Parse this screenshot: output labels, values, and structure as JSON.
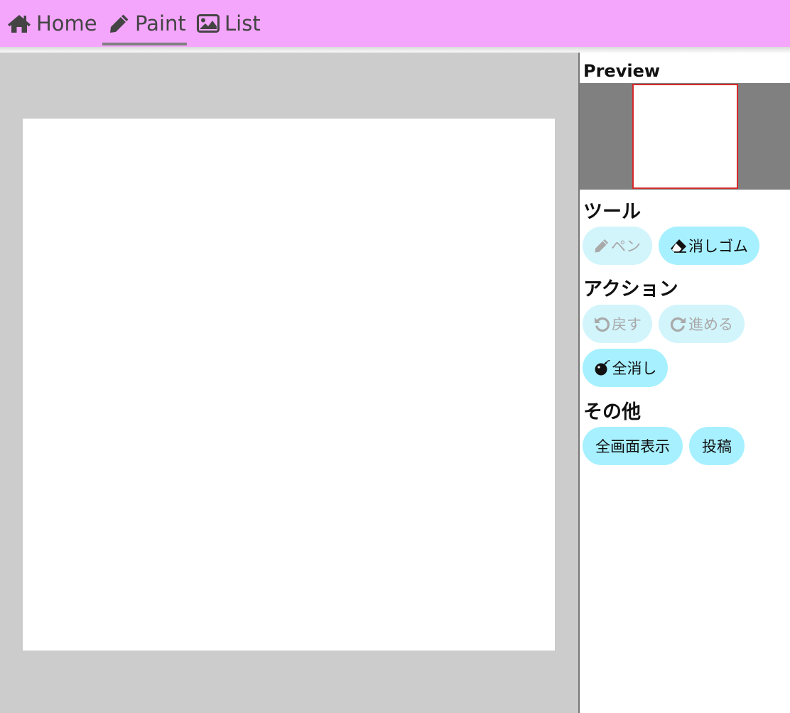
{
  "nav": {
    "items": [
      {
        "icon": "home-icon",
        "label": "Home"
      },
      {
        "icon": "pencil-icon",
        "label": "Paint"
      },
      {
        "icon": "image-icon",
        "label": "List"
      }
    ],
    "active": "Paint"
  },
  "panel": {
    "preview_heading": "Preview",
    "tools_heading": "ツール",
    "tools": {
      "pen": {
        "icon": "pencil-icon",
        "label": "ペン",
        "disabled": true
      },
      "eraser": {
        "icon": "eraser-icon",
        "label": "消しゴム",
        "disabled": false
      }
    },
    "action_heading": "アクション",
    "actions": {
      "undo": {
        "icon": "undo-icon",
        "label": "戻す",
        "disabled": true
      },
      "redo": {
        "icon": "redo-icon",
        "label": "進める",
        "disabled": true
      },
      "clear": {
        "icon": "bomb-icon",
        "label": "全消し",
        "disabled": false
      }
    },
    "other_heading": "その他",
    "other": {
      "fullscreen": {
        "label": "全画面表示"
      },
      "post": {
        "label": "投稿"
      }
    }
  },
  "colors": {
    "nav_bg": "#f4a6fc",
    "nav_text": "#444444",
    "active_underline": "#808080",
    "workspace_bg": "#cccccc",
    "canvas_bg": "#ffffff",
    "preview_bg": "#808080",
    "preview_border": "#d42a2a",
    "button_bg": "#a6f0ff",
    "button_disabled_bg": "#d2f5fc"
  }
}
